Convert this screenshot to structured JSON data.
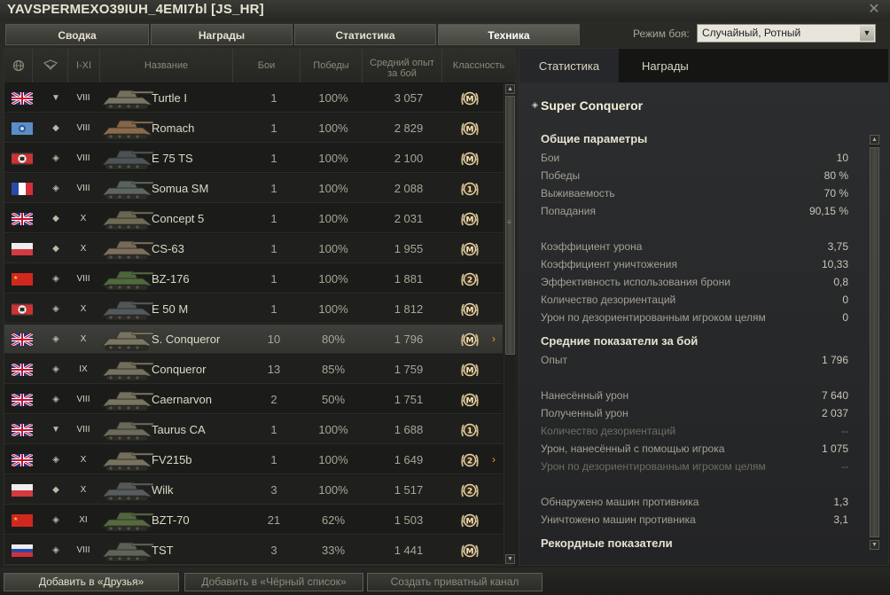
{
  "window": {
    "title": "YAVSPERMEXO39IUH_4EMI7bl [JS_HR]"
  },
  "tabs": [
    {
      "label": "Сводка",
      "active": false
    },
    {
      "label": "Награды",
      "active": false
    },
    {
      "label": "Статистика",
      "active": false
    },
    {
      "label": "Техника",
      "active": true
    }
  ],
  "battle_mode": {
    "label": "Режим боя:",
    "value": "Случайный, Ротный"
  },
  "table": {
    "headers": {
      "nation": "",
      "type": "",
      "tier": "I-XI",
      "name": "Название",
      "battles": "Бои",
      "wins": "Победы",
      "exp": "Средний опыт за бой",
      "mastery": "Классность"
    },
    "rows": [
      {
        "flag": "uk",
        "type": "▼",
        "tier": "VIII",
        "name": "Turtle I",
        "battles": "1",
        "wins": "100%",
        "exp": "3 057",
        "badge": "M",
        "chevron": false,
        "selected": false,
        "tank_color": "#7a7562"
      },
      {
        "flag": "cz",
        "type": "◆",
        "tier": "VIII",
        "name": "Romach",
        "battles": "1",
        "wins": "100%",
        "exp": "2 829",
        "badge": "M",
        "chevron": false,
        "selected": false,
        "tank_color": "#8a6a4c"
      },
      {
        "flag": "de",
        "type": "◈",
        "tier": "VIII",
        "name": "E 75 TS",
        "battles": "1",
        "wins": "100%",
        "exp": "2 100",
        "badge": "M",
        "chevron": false,
        "selected": false,
        "tank_color": "#4e5458"
      },
      {
        "flag": "fr",
        "type": "◈",
        "tier": "VIII",
        "name": "Somua SM",
        "battles": "1",
        "wins": "100%",
        "exp": "2 088",
        "badge": "1",
        "chevron": false,
        "selected": false,
        "tank_color": "#5d6760"
      },
      {
        "flag": "uk",
        "type": "◆",
        "tier": "X",
        "name": "Concept 5",
        "battles": "1",
        "wins": "100%",
        "exp": "2 031",
        "badge": "M",
        "chevron": false,
        "selected": false,
        "tank_color": "#6e6a55"
      },
      {
        "flag": "pl",
        "type": "◆",
        "tier": "X",
        "name": "CS-63",
        "battles": "1",
        "wins": "100%",
        "exp": "1 955",
        "badge": "M",
        "chevron": false,
        "selected": false,
        "tank_color": "#7c705c"
      },
      {
        "flag": "cn",
        "type": "◈",
        "tier": "VIII",
        "name": "BZ-176",
        "battles": "1",
        "wins": "100%",
        "exp": "1 881",
        "badge": "2",
        "chevron": false,
        "selected": false,
        "tank_color": "#4f6a3e"
      },
      {
        "flag": "de",
        "type": "◈",
        "tier": "X",
        "name": "E 50 M",
        "battles": "1",
        "wins": "100%",
        "exp": "1 812",
        "badge": "M",
        "chevron": false,
        "selected": false,
        "tank_color": "#535a5e"
      },
      {
        "flag": "uk",
        "type": "◈",
        "tier": "X",
        "name": "S. Conqueror",
        "battles": "10",
        "wins": "80%",
        "exp": "1 796",
        "badge": "M",
        "chevron": true,
        "selected": true,
        "tank_color": "#7b7663"
      },
      {
        "flag": "uk",
        "type": "◈",
        "tier": "IX",
        "name": "Conqueror",
        "battles": "13",
        "wins": "85%",
        "exp": "1 759",
        "badge": "M",
        "chevron": false,
        "selected": false,
        "tank_color": "#76725f"
      },
      {
        "flag": "uk",
        "type": "◈",
        "tier": "VIII",
        "name": "Caernarvon",
        "battles": "2",
        "wins": "50%",
        "exp": "1 751",
        "badge": "M",
        "chevron": false,
        "selected": false,
        "tank_color": "#787561"
      },
      {
        "flag": "uk",
        "type": "▼",
        "tier": "VIII",
        "name": "Taurus CA",
        "battles": "1",
        "wins": "100%",
        "exp": "1 688",
        "badge": "1",
        "chevron": false,
        "selected": false,
        "tank_color": "#6c6b5c"
      },
      {
        "flag": "uk",
        "type": "◈",
        "tier": "X",
        "name": "FV215b",
        "battles": "1",
        "wins": "100%",
        "exp": "1 649",
        "badge": "2",
        "chevron": true,
        "selected": false,
        "tank_color": "#77735f"
      },
      {
        "flag": "pl",
        "type": "◆",
        "tier": "X",
        "name": "Wilk",
        "battles": "3",
        "wins": "100%",
        "exp": "1 517",
        "badge": "2",
        "chevron": false,
        "selected": false,
        "tank_color": "#585c5e"
      },
      {
        "flag": "cn",
        "type": "◈",
        "tier": "XI",
        "name": "BZT-70",
        "battles": "21",
        "wins": "62%",
        "exp": "1 503",
        "badge": "M",
        "chevron": false,
        "selected": false,
        "tank_color": "#556b3f"
      },
      {
        "flag": "ru",
        "type": "◈",
        "tier": "VIII",
        "name": "TST",
        "battles": "3",
        "wins": "33%",
        "exp": "1 441",
        "badge": "M",
        "chevron": false,
        "selected": false,
        "tank_color": "#5f6458"
      }
    ]
  },
  "right": {
    "tabs": [
      {
        "label": "Статистика"
      },
      {
        "label": "Награды"
      }
    ],
    "vehicle_name": "Super Conqueror",
    "stats": [
      {
        "kind": "sec",
        "label": "Общие параметры"
      },
      {
        "kind": "row",
        "label": "Бои",
        "value": "10"
      },
      {
        "kind": "row",
        "label": "Победы",
        "value": "80 %"
      },
      {
        "kind": "row",
        "label": "Выживаемость",
        "value": "70 %"
      },
      {
        "kind": "row",
        "label": "Попадания",
        "value": "90,15 %"
      },
      {
        "kind": "gap"
      },
      {
        "kind": "row",
        "label": "Коэффициент урона",
        "value": "3,75"
      },
      {
        "kind": "row",
        "label": "Коэффициент уничтожения",
        "value": "10,33"
      },
      {
        "kind": "row",
        "label": "Эффективность использования брони",
        "value": "0,8"
      },
      {
        "kind": "row",
        "label": "Количество дезориентаций",
        "value": "0"
      },
      {
        "kind": "row",
        "label": "Урон по дезориентированным игроком целям",
        "value": "0"
      },
      {
        "kind": "sec",
        "label": "Средние показатели за бой"
      },
      {
        "kind": "row",
        "label": "Опыт",
        "value": "1 796"
      },
      {
        "kind": "gap"
      },
      {
        "kind": "row",
        "label": "Нанесённый урон",
        "value": "7 640"
      },
      {
        "kind": "row",
        "label": "Полученный урон",
        "value": "2 037"
      },
      {
        "kind": "row",
        "label": "Количество дезориентаций",
        "value": "--",
        "dim": true
      },
      {
        "kind": "row",
        "label": "Урон, нанесённый с помощью игрока",
        "value": "1 075"
      },
      {
        "kind": "row",
        "label": "Урон по дезориентированным игроком целям",
        "value": "--",
        "dim": true
      },
      {
        "kind": "gap"
      },
      {
        "kind": "row",
        "label": "Обнаружено машин противника",
        "value": "1,3"
      },
      {
        "kind": "row",
        "label": "Уничтожено машин противника",
        "value": "3,1"
      },
      {
        "kind": "sec",
        "label": "Рекордные показатели"
      }
    ]
  },
  "bottom_buttons": [
    {
      "label": "Добавить в «Друзья»",
      "enabled": true
    },
    {
      "label": "Добавить в «Чёрный список»",
      "enabled": false
    },
    {
      "label": "Создать приватный канал",
      "enabled": false
    }
  ],
  "colors": {
    "accent_chevron": "#e0a020",
    "badge_gold": "#e8d7a6"
  }
}
